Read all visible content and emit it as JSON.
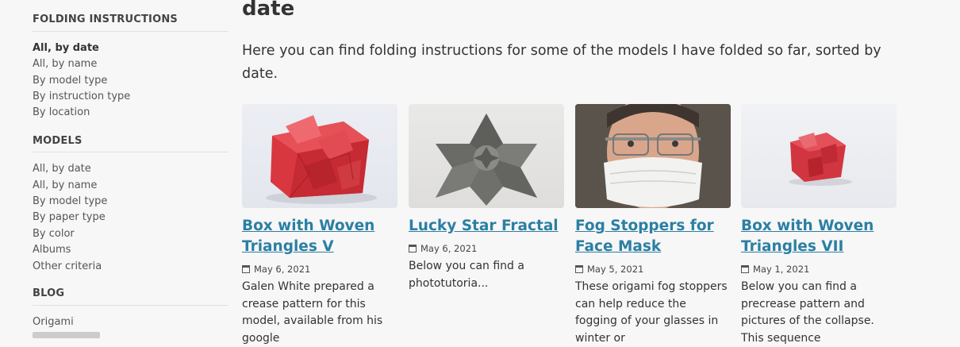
{
  "sidebar": {
    "sections": [
      {
        "title": "FOLDING INSTRUCTIONS",
        "items": [
          "All, by date",
          "All, by name",
          "By model type",
          "By instruction type",
          "By location"
        ]
      },
      {
        "title": "MODELS",
        "items": [
          "All, by date",
          "All, by name",
          "By model type",
          "By paper type",
          "By color",
          "Albums",
          "Other criteria"
        ]
      },
      {
        "title": "BLOG",
        "items": [
          "Origami"
        ]
      }
    ]
  },
  "main": {
    "title_fragment": "date",
    "intro": "Here you can find folding instructions for some of the models I have folded so far, sorted by date.",
    "cards": [
      {
        "title": "Box with Woven Triangles V",
        "date": "May 6, 2021",
        "desc": "Galen White prepared a crease pattern for this model, available from his google"
      },
      {
        "title": "Lucky Star Fractal",
        "date": "May 6, 2021",
        "desc": "Below you can find a phototutoria..."
      },
      {
        "title": "Fog Stoppers for Face Mask",
        "date": "May 5, 2021",
        "desc": "These origami fog stoppers can help reduce the fogging of your glasses in winter or"
      },
      {
        "title": "Box with Woven Triangles VII",
        "date": "May 1, 2021",
        "desc": "Below you can find a precrease pattern and pictures of the collapse. This sequence"
      }
    ]
  }
}
